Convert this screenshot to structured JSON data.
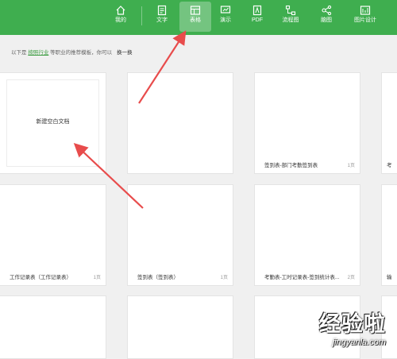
{
  "nav": {
    "items": [
      {
        "label": "我的",
        "icon": "home-icon"
      },
      {
        "label": "文字",
        "icon": "document-icon"
      },
      {
        "label": "表格",
        "icon": "table-icon",
        "active": true
      },
      {
        "label": "演示",
        "icon": "presentation-icon"
      },
      {
        "label": "PDF",
        "icon": "pdf-icon"
      },
      {
        "label": "流程图",
        "icon": "flowchart-icon"
      },
      {
        "label": "脑图",
        "icon": "mindmap-icon"
      },
      {
        "label": "图片设计",
        "icon": "picture-design-icon"
      }
    ],
    "accent_color": "#3fae4f"
  },
  "subtitle": {
    "prefix": "以下是",
    "link": "按照行业",
    "suffix": "等职业的推荐模板，你可以",
    "switch": "换一换"
  },
  "cards": [
    {
      "title": "",
      "pages": "",
      "center_label": "新建空白文档"
    },
    {
      "title": "",
      "pages": "",
      "center_label": ""
    },
    {
      "title": "签到表-部门考勤签到表",
      "pages": "1页",
      "center_label": ""
    },
    {
      "title": "考",
      "pages": "",
      "center_label": ""
    },
    {
      "title": "工作记录表（工作记录表）",
      "pages": "1页",
      "center_label": ""
    },
    {
      "title": "签到表（签到表）",
      "pages": "1页",
      "center_label": ""
    },
    {
      "title": "考勤表-工时记录表-签到统计表...",
      "pages": "2页",
      "center_label": ""
    },
    {
      "title": "输",
      "pages": "",
      "center_label": ""
    },
    {
      "title": "",
      "pages": "",
      "center_label": ""
    },
    {
      "title": "",
      "pages": "",
      "center_label": ""
    },
    {
      "title": "",
      "pages": "",
      "center_label": ""
    },
    {
      "title": "",
      "pages": "",
      "center_label": ""
    }
  ],
  "annotation": {
    "arrow_color": "#e84c4c"
  },
  "watermark": {
    "main": "经验啦",
    "url": "jingyanla.com"
  }
}
